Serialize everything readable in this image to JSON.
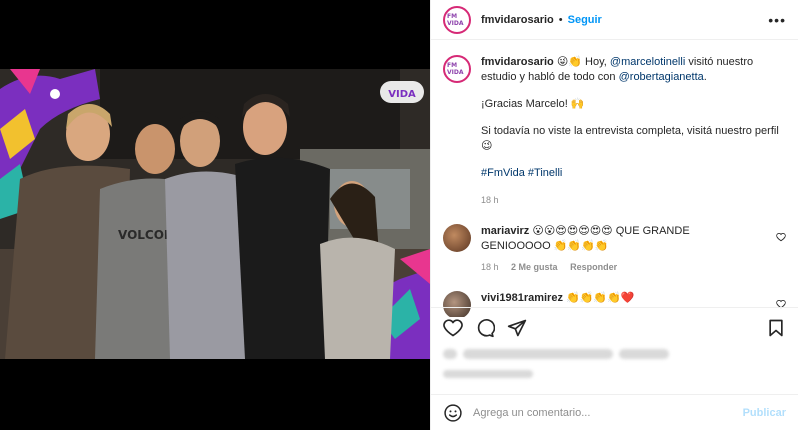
{
  "post": {
    "username": "fmvidarosario",
    "follow_label": "Seguir",
    "separator": "•",
    "more_label": "•••",
    "logo_text": "FM VIDA"
  },
  "caption": {
    "username": "fmvidarosario",
    "emojis": "😜👏",
    "text_a": " Hoy, ",
    "mention_1": "@marcelotinelli",
    "text_b": " visitó nuestro estudio y habló de todo con ",
    "mention_2": "@robertagianetta",
    "text_c": ".",
    "line2": "¡Gracias Marcelo! 🙌",
    "line3": "Si todavía no viste la entrevista completa, visitá nuestro perfil 😉",
    "hashtag_1": "#FmVida",
    "hashtag_2": "#Tinelli",
    "time": "18 h"
  },
  "comments": [
    {
      "username": "mariavirz",
      "text": "😮😮😍😍😍😍😍 QUE GRANDE GENIOOOOO 👏👏👏👏",
      "time": "18 h",
      "likes": "2 Me gusta",
      "reply": "Responder",
      "avatar_color": "#7a4a2a"
    },
    {
      "username": "vivi1981ramirez",
      "text": "👏👏👏👏❤️",
      "avatar_color": "#5a4a40"
    }
  ],
  "composer": {
    "placeholder": "Agrega un comentario...",
    "publish_label": "Publicar"
  },
  "colors": {
    "link": "#00376b",
    "accent": "#0095f6",
    "muted": "#8e8e8e"
  }
}
